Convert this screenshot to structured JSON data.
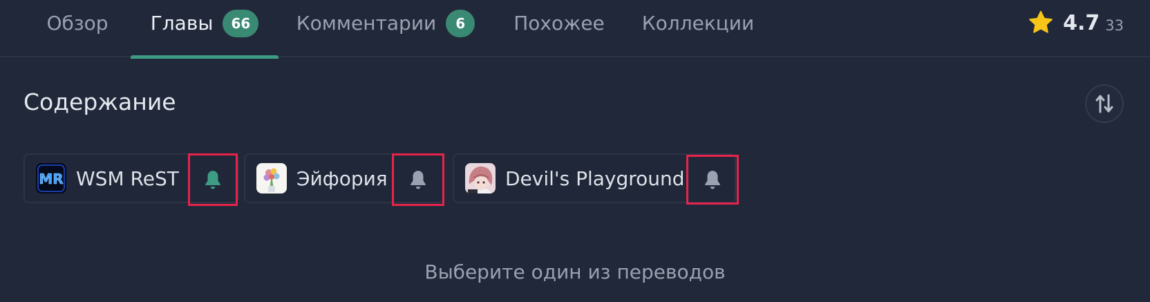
{
  "tabs": {
    "overview": {
      "label": "Обзор"
    },
    "chapters": {
      "label": "Главы",
      "badge": "66"
    },
    "comments": {
      "label": "Комментарии",
      "badge": "6"
    },
    "similar": {
      "label": "Похожее"
    },
    "collections": {
      "label": "Коллекции"
    }
  },
  "rating": {
    "value": "4.7",
    "count": "33",
    "icon": "star-icon",
    "color": "#f5c518"
  },
  "content": {
    "title": "Содержание",
    "sort_icon": "sort-arrows-icon",
    "translators": [
      {
        "name": "WSM ReST",
        "avatar_text": "MR",
        "bell_icon": "bell-icon",
        "bell_color": "#3d9c84",
        "subscribed": true
      },
      {
        "name": "Эйфория",
        "avatar_icon": "flower-bouquet-icon",
        "bell_icon": "bell-icon",
        "bell_color": "#9aa2b1",
        "subscribed": false
      },
      {
        "name": "Devil's Playground",
        "avatar_icon": "anime-character-icon",
        "bell_icon": "bell-icon",
        "bell_color": "#9aa2b1",
        "subscribed": false
      }
    ],
    "hint": "Выберите один из переводов"
  },
  "colors": {
    "accent": "#3d9c84",
    "background": "#212839",
    "highlight_box": "#e8234b"
  }
}
